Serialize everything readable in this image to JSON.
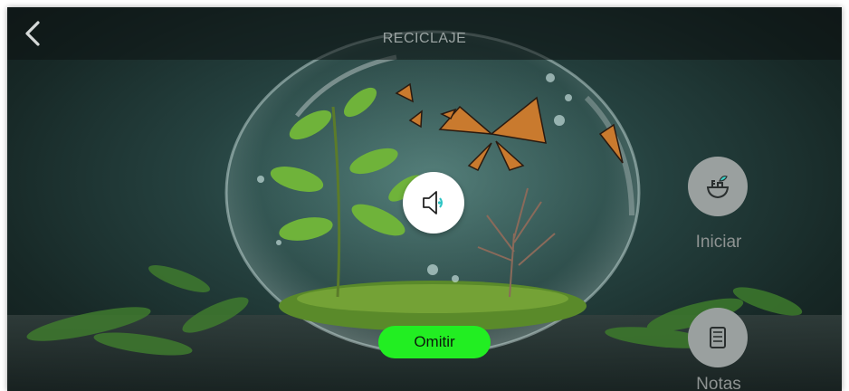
{
  "header": {
    "title": "RECICLAJE"
  },
  "icons": {
    "back": "chevron-left-icon",
    "audio": "speaker-icon",
    "start": "plant-pot-icon",
    "notes": "notes-icon"
  },
  "controls": {
    "skip_label": "Omitir",
    "start_label": "Iniciar",
    "notes_label": "Notas"
  },
  "colors": {
    "skip_button": "#22ee22",
    "side_buttons": "#9aa09f",
    "audio_accent": "#2ec4c4"
  }
}
